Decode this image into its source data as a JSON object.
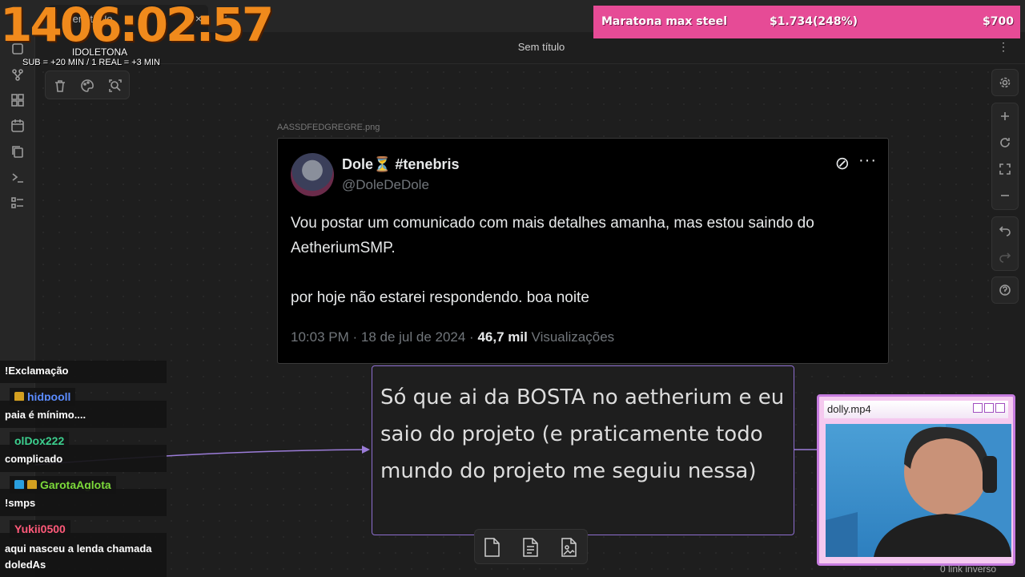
{
  "window": {
    "tab_title": "Sem título",
    "new_tab_glyph": "+",
    "close_glyph": "×"
  },
  "toolbar": {
    "doc_title": "Sem título",
    "more_glyph": "⋮"
  },
  "ribbon_icons": [
    "file-explorer-icon",
    "graph-icon",
    "grid-icon",
    "calendar-icon",
    "copy-icon",
    "terminal-icon",
    "list-icon"
  ],
  "canvas_tools": [
    "trash-icon",
    "palette-icon",
    "zoom-icon"
  ],
  "right_controls": {
    "top": [
      "settings-icon"
    ],
    "zoom": [
      "plus-icon",
      "reset-icon",
      "fit-icon",
      "minus-icon"
    ],
    "history": [
      "undo-icon",
      "redo-icon"
    ],
    "help": [
      "help-icon"
    ]
  },
  "image_node": {
    "filename": "AASSDFEDGREGRE.png",
    "tweet": {
      "name": "Dole⏳ #tenebris",
      "handle": "@DoleDeDole",
      "body": [
        "Vou postar um comunicado com mais detalhes amanha, mas estou saindo do AetheriumSMP.",
        "por hoje não estarei respondendo. boa noite"
      ],
      "time": "10:03 PM · 18 de jul de 2024 · ",
      "views": "46,7 mil",
      "views_label": " Visualizações"
    }
  },
  "text_node": {
    "text": "Só que ai da BOSTA no aetherium e eu saio do projeto (e praticamente todo mundo do projeto me seguiu nessa)"
  },
  "bottom_tools": [
    "new-card-icon",
    "note-icon",
    "media-icon"
  ],
  "overlay": {
    "timer": "1406:02:57",
    "subtitle": "IDOLETONA",
    "rate": "SUB = +20  MIN / 1 REAL = +3 MIN",
    "goal": {
      "name": "Maratona max steel",
      "progress": "$1.734(248%)",
      "target": "$700",
      "color": "#e64b96"
    }
  },
  "chat": [
    {
      "user": "",
      "text": "!Exclamação"
    },
    {
      "user": "hidpooll",
      "color": "#5b8cff",
      "text": "paia é mínimo...."
    },
    {
      "user": "olDox222",
      "color": "#3ccf8e",
      "text": "complicado"
    },
    {
      "user": "GarotaAglota",
      "color": "#7cd93a",
      "text": "!smps"
    },
    {
      "user": "Yukii0500",
      "color": "#ff5a7a",
      "text": "aqui nasceu a lenda chamada doledAs"
    }
  ],
  "webcam": {
    "title": "dolly.mp4"
  },
  "footer": {
    "link_inverso": "0 link inverso"
  }
}
